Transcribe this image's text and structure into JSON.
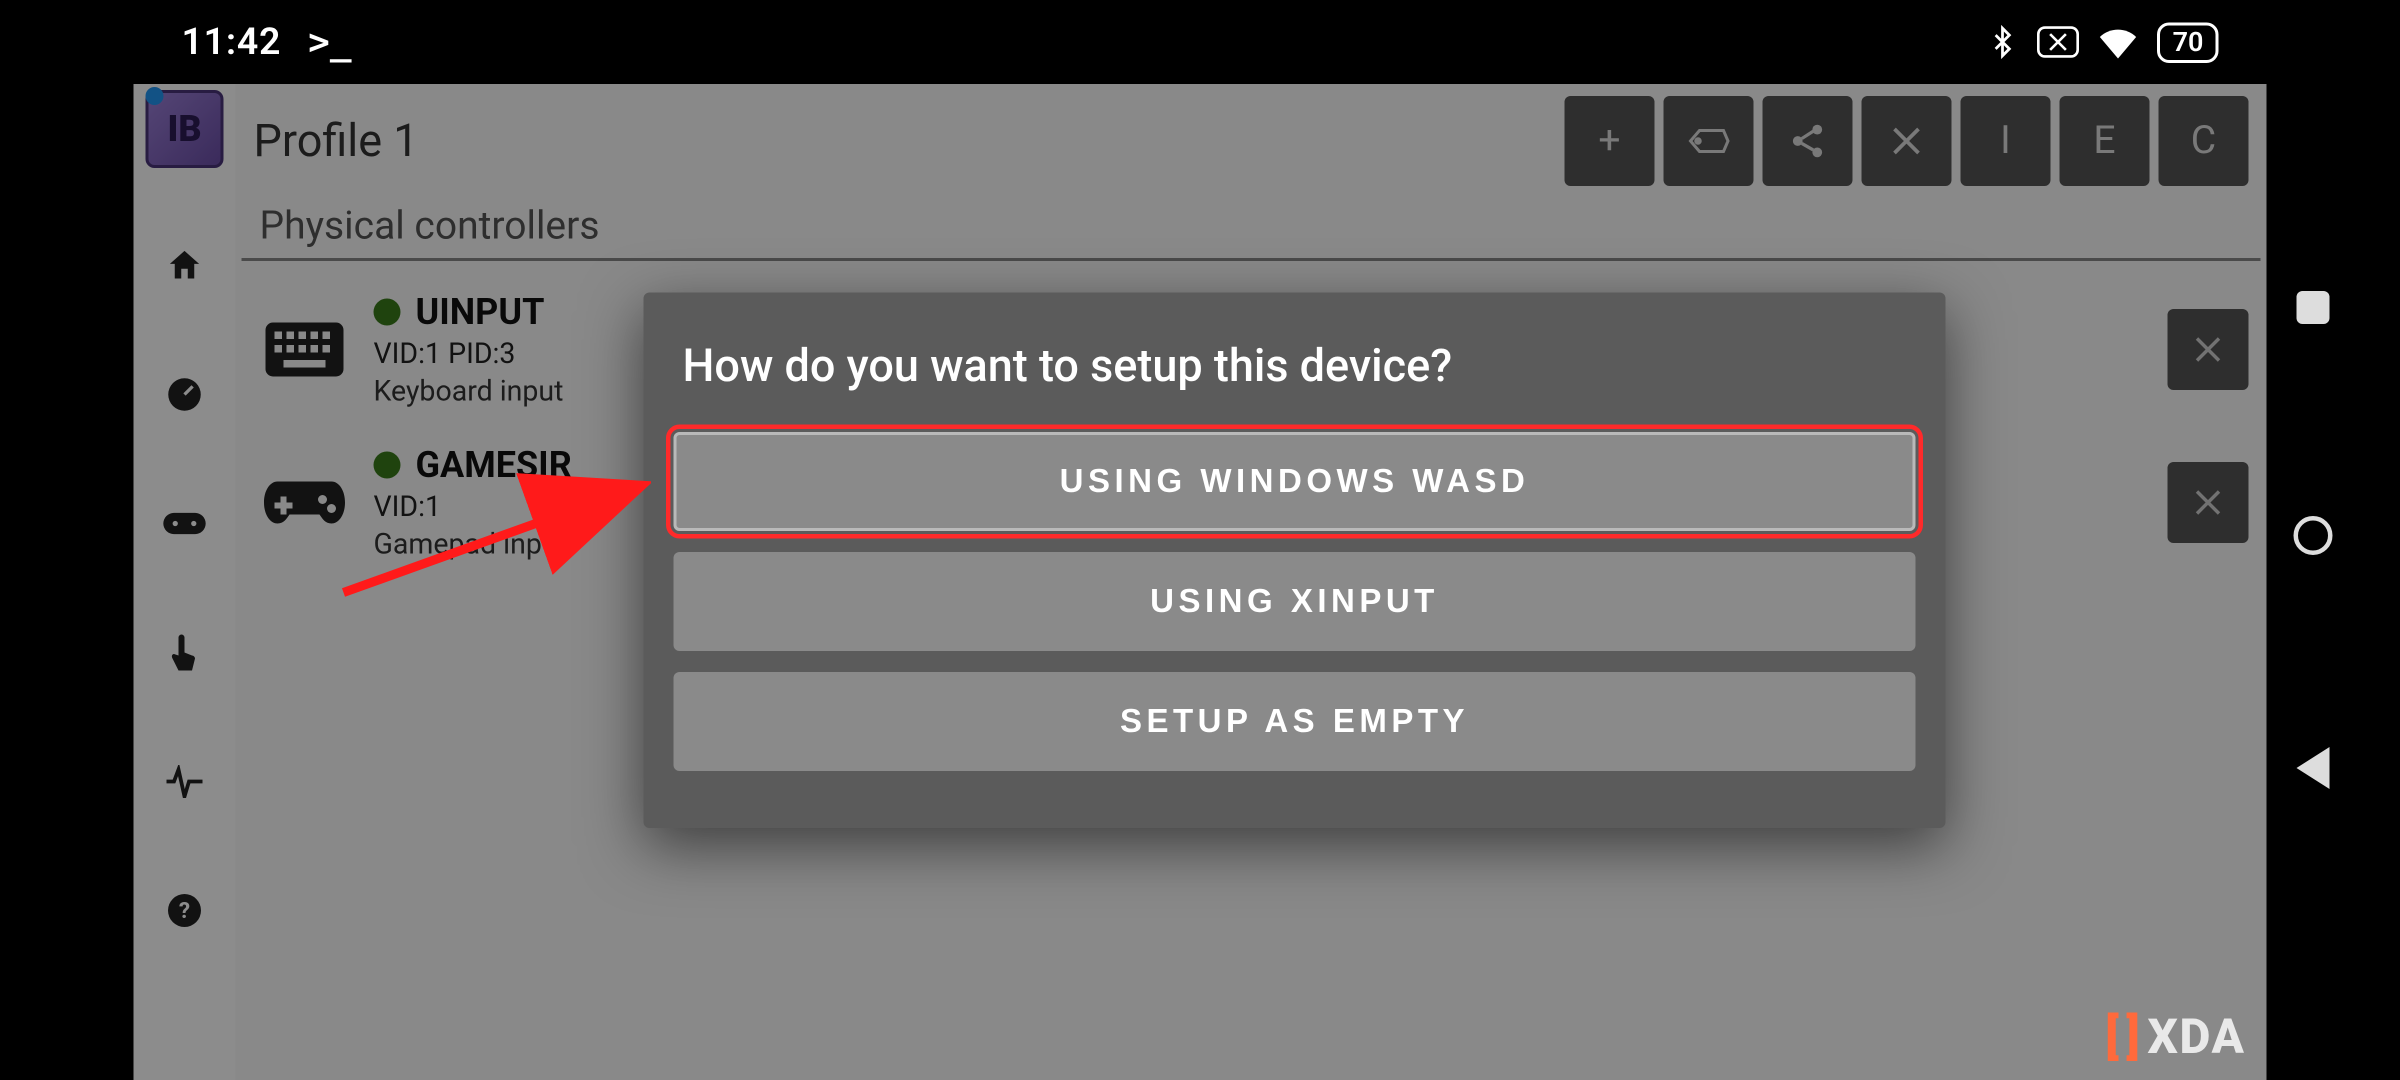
{
  "status": {
    "time": "11:42",
    "battery": "70"
  },
  "header": {
    "profile_title": "Profile 1",
    "buttons": {
      "add": "+",
      "i": "I",
      "e": "E",
      "c": "C"
    }
  },
  "section": {
    "title": "Physical controllers"
  },
  "devices": [
    {
      "name": "UINPUT",
      "ids": "VID:1 PID:3",
      "desc": "Keyboard input"
    },
    {
      "name": "GAMESIR",
      "ids": "VID:1",
      "desc": "Gamepad input"
    }
  ],
  "modal": {
    "title": "How do you want to setup this device?",
    "options": [
      "USING WINDOWS WASD",
      "USING XINPUT",
      "SETUP AS EMPTY"
    ]
  },
  "logo": {
    "text": "IB"
  },
  "watermark": {
    "text": "XDA"
  }
}
